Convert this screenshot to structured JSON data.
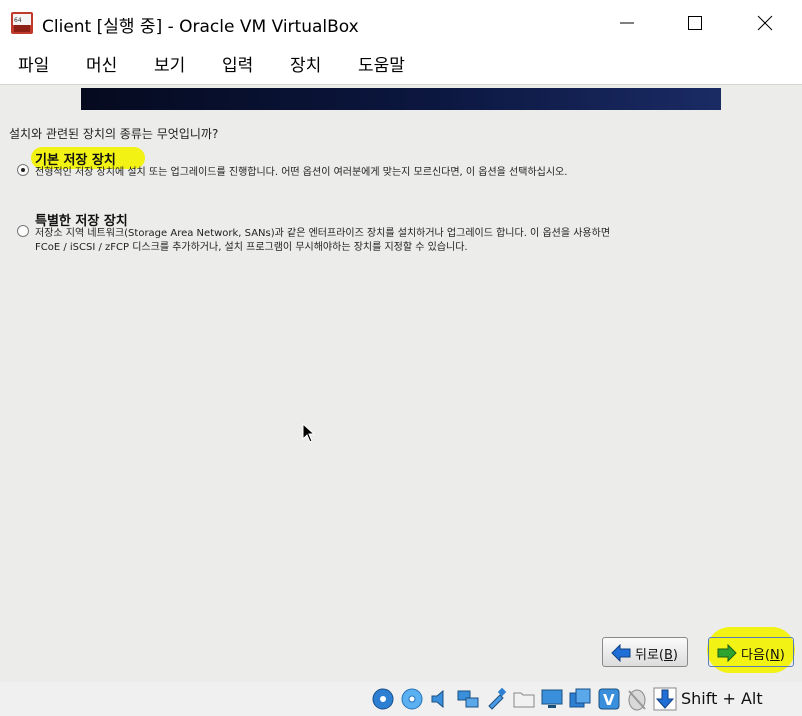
{
  "window": {
    "title": "Client [실행 중] - Oracle VM VirtualBox"
  },
  "menu": [
    "파일",
    "머신",
    "보기",
    "입력",
    "장치",
    "도움말"
  ],
  "installer": {
    "question": "설치와 관련된 장치의 종류는 무엇입니까?",
    "options": [
      {
        "title": "기본 저장 장치",
        "desc": "전형적인 저장 장치에 설치 또는 업그레이드를 진행합니다. 어떤 옵션이 여러분에게 맞는지 모르신다면, 이 옵션을 선택하십시오.",
        "selected": true
      },
      {
        "title": "특별한 저장 장치",
        "desc": "저장소 지역 네트워크(Storage Area Network, SANs)과 같은 엔터프라이즈 장치를 설치하거나 업그레이드 합니다. 이 옵션을 사용하면 FCoE / iSCSI / zFCP 디스크를 추가하거나, 설치 프로그램이 무시해야하는 장치를 지정할 수 있습니다.",
        "selected": false
      }
    ],
    "back": {
      "text": "뒤로(",
      "key": "B",
      "close": ")"
    },
    "next": {
      "text": "다음(",
      "key": "N",
      "close": ")"
    }
  },
  "status": {
    "host_key": "Shift + Alt",
    "icons": [
      "disk-icon",
      "optical-drive-icon",
      "audio-icon",
      "network-icon",
      "usb-icon",
      "shared-folder-icon",
      "display-icon",
      "recording-icon",
      "virtualization-icon",
      "mouse-integration-icon",
      "host-key-arrow-icon"
    ]
  },
  "colors": {
    "highlight": "#f2f214",
    "banner": "#0c1740",
    "vm_bg": "#ececeb",
    "arrow_blue": "#1f6fd6",
    "arrow_green": "#2fa32f"
  }
}
